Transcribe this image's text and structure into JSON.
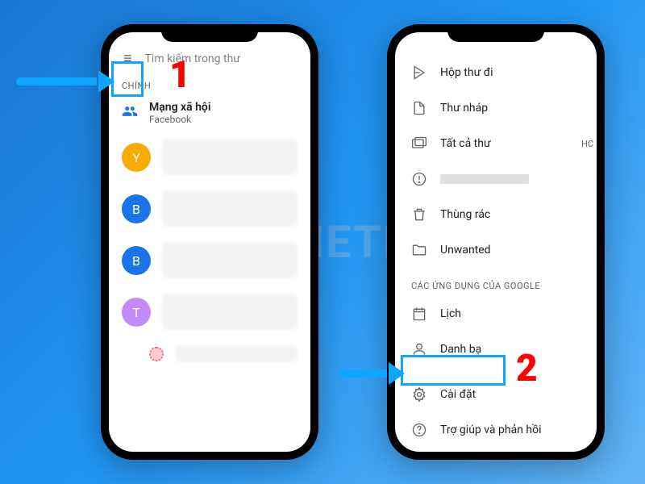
{
  "watermark": "VIETNIX",
  "step_numbers": {
    "one": "1",
    "two": "2"
  },
  "left": {
    "search_placeholder": "Tìm kiếm trong thư",
    "section_primary": "CHÍNH",
    "social_title": "Mạng xã hội",
    "social_sub": "Facebook",
    "avatars": [
      {
        "letter": "Y",
        "color": "#f9ab00"
      },
      {
        "letter": "B",
        "color": "#1a73e8"
      },
      {
        "letter": "B",
        "color": "#1a73e8"
      },
      {
        "letter": "T",
        "color": "#c58af9"
      }
    ]
  },
  "right": {
    "items_top": [
      {
        "icon": "send",
        "label": "Hộp thư đi"
      },
      {
        "icon": "draft",
        "label": "Thư nháp"
      },
      {
        "icon": "allmail",
        "label": "Tất cả thư",
        "trailing": "HC"
      },
      {
        "icon": "spam",
        "label": ""
      },
      {
        "icon": "trash",
        "label": "Thùng rác"
      },
      {
        "icon": "folder",
        "label": "Unwanted"
      }
    ],
    "section_apps": "CÁC ỨNG DỤNG CỦA GOOGLE",
    "items_apps": [
      {
        "icon": "calendar",
        "label": "Lịch"
      },
      {
        "icon": "contacts",
        "label": "Danh bạ"
      }
    ],
    "items_bottom": [
      {
        "icon": "settings",
        "label": "Cài đặt"
      },
      {
        "icon": "help",
        "label": "Trợ giúp và phản hồi"
      }
    ]
  }
}
